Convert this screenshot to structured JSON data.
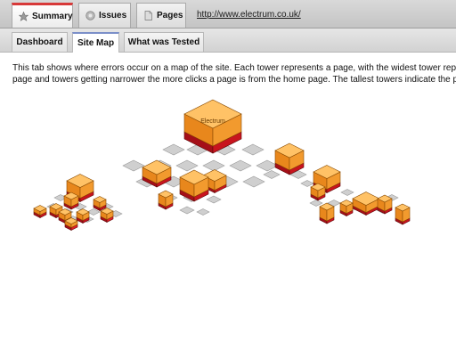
{
  "top_tabs": [
    {
      "label": "Summary",
      "icon": "star-icon",
      "active": true
    },
    {
      "label": "Issues",
      "icon": "issues-icon",
      "active": false
    },
    {
      "label": "Pages",
      "icon": "page-icon",
      "active": false
    }
  ],
  "site_url": "http://www.electrum.co.uk/",
  "sub_tabs": [
    {
      "label": "Dashboard",
      "active": false
    },
    {
      "label": "Site Map",
      "active": true
    },
    {
      "label": "What was Tested",
      "active": false
    }
  ],
  "description": {
    "line1": "This tab shows where errors occur on a map of the site. Each tower represents a page, with the widest tower representing the home",
    "line2": "page and towers getting narrower the more clicks a page is from the home page. The tallest towers indicate the pages with the most errors."
  },
  "site_map": {
    "home_label": "Electrum"
  },
  "colors": {
    "active_tab_accent": "#d83a3a",
    "subtab_accent": "#7b8fc9",
    "tower_top": "#ffc266",
    "tower_side": "#f29a2e",
    "tower_base": "#c8141e",
    "page_tile": "#cfcfcf"
  }
}
